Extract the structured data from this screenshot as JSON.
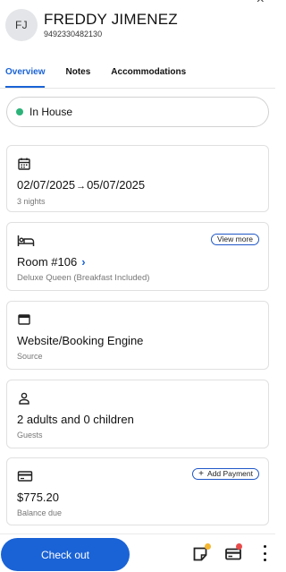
{
  "window": {
    "close_symbol": "×"
  },
  "guest": {
    "initials": "FJ",
    "name": "FREDDY JIMENEZ",
    "phone": "9492330482130"
  },
  "tabs": [
    {
      "label": "Overview",
      "active": true
    },
    {
      "label": "Notes",
      "active": false
    },
    {
      "label": "Accommodations",
      "active": false
    }
  ],
  "status": {
    "label": "In House",
    "color": "#2db37a"
  },
  "stay": {
    "icon": "calendar-icon",
    "check_in": "02/07/2025",
    "arrow": "→",
    "check_out": "05/07/2025",
    "nights": "3 nights"
  },
  "room": {
    "icon": "bed-icon",
    "number": "Room #106",
    "type": "Deluxe Queen (Breakfast Included)",
    "view_more_label": "View  more"
  },
  "source": {
    "icon": "browser-window-icon",
    "value": "Website/Booking Engine",
    "label": "Source"
  },
  "guests": {
    "icon": "person-icon",
    "value": "2 adults and 0 children",
    "label": "Guests"
  },
  "balance": {
    "icon": "credit-card-icon",
    "amount": "$775.20",
    "label": "Balance due",
    "add_payment_label": "Add Payment"
  },
  "footer": {
    "checkout_label": "Check out",
    "note_badge_color": "#f5b731",
    "payment_badge_color": "#e94b4b",
    "accent": "#1a63d6"
  }
}
